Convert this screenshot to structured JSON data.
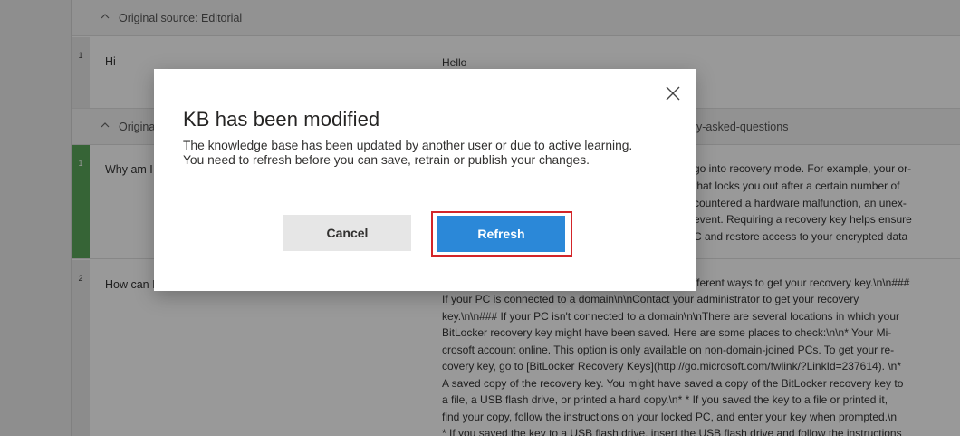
{
  "background": {
    "section1_header": "Original source: Editorial",
    "section2_header_left": "Origina",
    "section2_header_right": "y-asked-questions",
    "rows": [
      {
        "num": "1",
        "question": "Hi",
        "answer": "Hello"
      },
      {
        "num": "1",
        "question": "Why am I",
        "answer_lines": [
          "go into recovery mode. For example, your or-",
          "that locks you out after a certain number of",
          "countered a hardware malfunction, an unex-",
          "event. Requiring a recovery key helps ensure",
          "C and restore access to your encrypted data"
        ]
      },
      {
        "num": "2",
        "question": "How can I",
        "answer_lines": [
          "fferent ways to get your recovery key.\\n\\n###",
          "If your PC is connected to a domain\\n\\nContact your administrator to get your recovery",
          "key.\\n\\n### If your PC isn't connected to a domain\\n\\nThere are several locations in which your",
          "BitLocker recovery key might have been saved. Here are some places to check:\\n\\n* Your Mi-",
          "crosoft account online. This option is only available on non-domain-joined PCs. To get your re-",
          "covery key, go to [BitLocker Recovery Keys](http://go.microsoft.com/fwlink/?LinkId=237614). \\n*",
          "A saved copy of the recovery key. You might have saved a copy of the BitLocker recovery key to",
          "a file, a USB flash drive, or printed a hard copy.\\n* * If you saved the key to a file or printed it,",
          "find your copy, follow the instructions on your locked PC, and enter your key when prompted.\\n",
          "* If you saved the key to a USB flash drive, insert the USB flash drive and follow the instructions"
        ]
      }
    ]
  },
  "dialog": {
    "title": "KB has been modified",
    "message": "The knowledge base has been updated by another user or due to active learning. You need to refresh before you can save, retrain or publish your changes.",
    "cancel_label": "Cancel",
    "refresh_label": "Refresh",
    "close_icon": "close-icon"
  },
  "colors": {
    "primary_button": "#2b88d8",
    "highlight_border": "#d32529",
    "green_marker": "#5aa75a"
  }
}
